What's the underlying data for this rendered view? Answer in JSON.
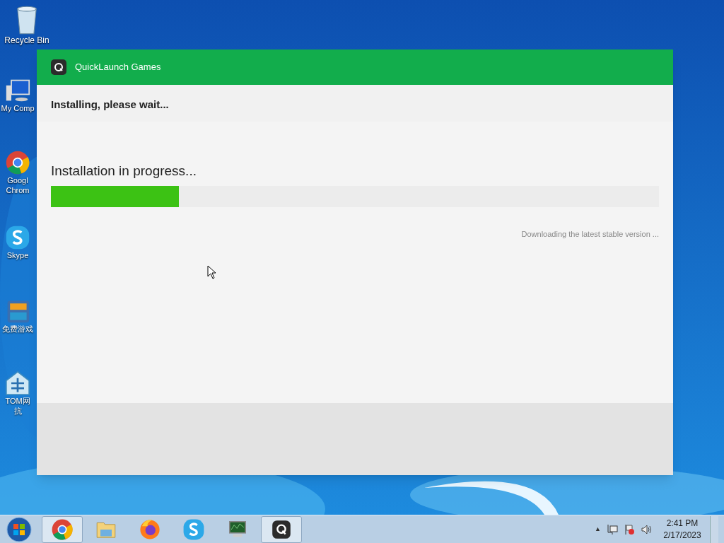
{
  "desktop_icons": [
    {
      "kind": "bin",
      "label": [
        "Recycle Bin"
      ]
    },
    {
      "kind": "computer",
      "label": [
        "My Comp"
      ]
    },
    {
      "kind": "chrome",
      "label": [
        "Googl",
        "Chrom"
      ]
    },
    {
      "kind": "skype",
      "label": [
        "Skype"
      ]
    },
    {
      "kind": "game",
      "label": [
        "免费游戏"
      ]
    },
    {
      "kind": "network",
      "label": [
        "TOM网",
        "抗"
      ]
    }
  ],
  "window": {
    "title": "QuickLaunch Games",
    "heading": "Installing, please wait...",
    "status": "Installation in progress...",
    "progress": {
      "level": 0.21
    },
    "detail": "Downloading the latest stable version ..."
  },
  "taskbar": {
    "apps": [
      {
        "kind": "chrome",
        "selected": true
      },
      {
        "kind": "folder",
        "selected": false
      },
      {
        "kind": "firefox",
        "selected": false
      },
      {
        "kind": "skype",
        "selected": false
      },
      {
        "kind": "monitor",
        "selected": false
      },
      {
        "kind": "quick",
        "selected": true
      }
    ],
    "tray_arrow": "▲",
    "time": "2:41 PM",
    "date": "2/17/2023"
  }
}
